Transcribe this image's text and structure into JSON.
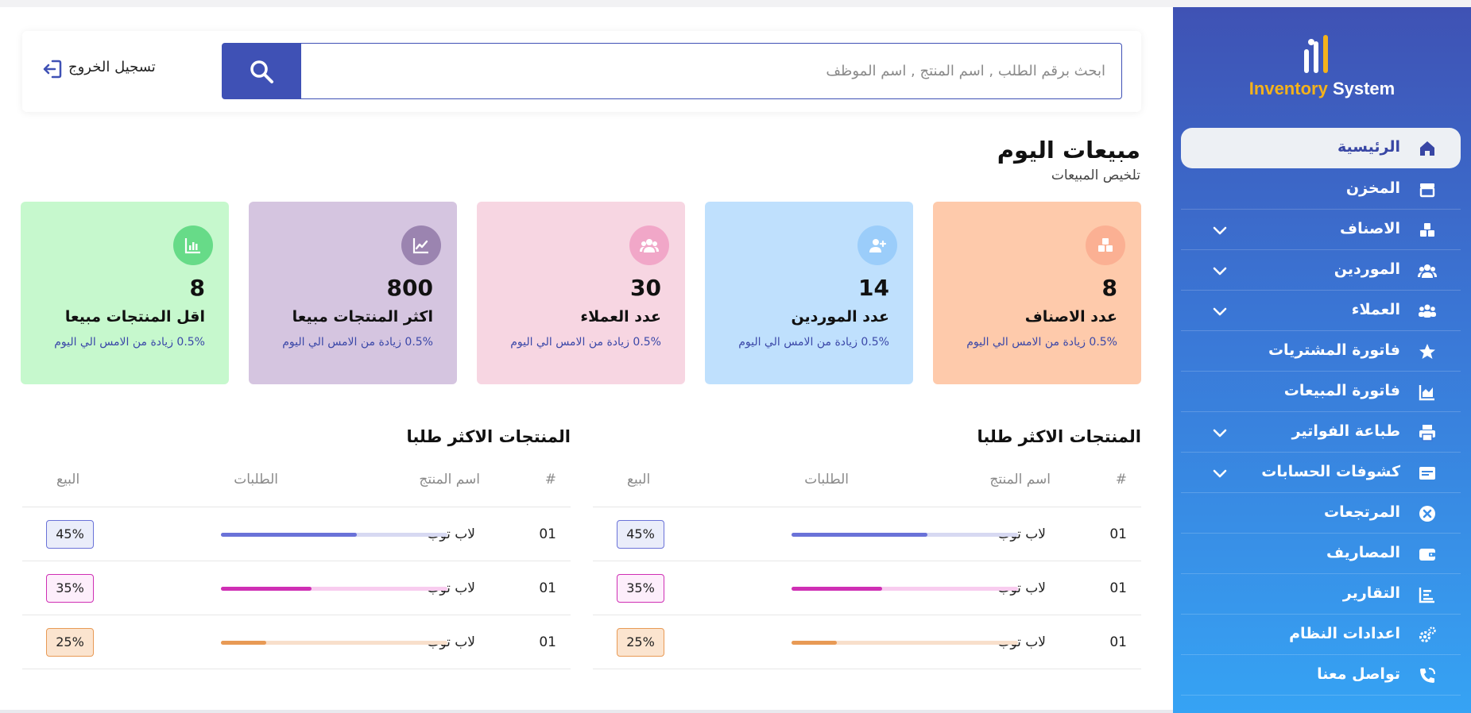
{
  "sidebar": {
    "logo": {
      "word1": "Inventory",
      "word2": "System"
    },
    "items": [
      {
        "label": "الرئيسية",
        "icon": "home-icon",
        "active": true,
        "has_submenu": false
      },
      {
        "label": "المخزن",
        "icon": "store-icon",
        "active": false,
        "has_submenu": false
      },
      {
        "label": "الاصناف",
        "icon": "boxes-icon",
        "active": false,
        "has_submenu": true
      },
      {
        "label": "الموردين",
        "icon": "users-icon",
        "active": false,
        "has_submenu": true
      },
      {
        "label": "العملاء",
        "icon": "customers-icon",
        "active": false,
        "has_submenu": true
      },
      {
        "label": "فاتورة المشتريات",
        "icon": "star-icon",
        "active": false,
        "has_submenu": false
      },
      {
        "label": "فاتورة المبيعات",
        "icon": "area-chart-icon",
        "active": false,
        "has_submenu": false
      },
      {
        "label": "طباعة الفواتير",
        "icon": "printer-icon",
        "active": false,
        "has_submenu": true
      },
      {
        "label": "كشوفات الحسابات",
        "icon": "id-card-icon",
        "active": false,
        "has_submenu": true
      },
      {
        "label": "المرتجعات",
        "icon": "x-circle-icon",
        "active": false,
        "has_submenu": false
      },
      {
        "label": "المصاريف",
        "icon": "wallet-icon",
        "active": false,
        "has_submenu": false
      },
      {
        "label": "التقارير",
        "icon": "report-icon",
        "active": false,
        "has_submenu": false
      },
      {
        "label": "اعدادات النظام",
        "icon": "gears-icon",
        "active": false,
        "has_submenu": false
      },
      {
        "label": "تواصل معنا",
        "icon": "phone-icon",
        "active": false,
        "has_submenu": false
      }
    ]
  },
  "header": {
    "search_placeholder": "ابحث برقم الطلب , اسم المنتج , اسم الموظف",
    "logout_label": "تسجيل الخروج"
  },
  "summary": {
    "title": "مبيعات اليوم",
    "subtitle": "تلخيص المبيعات"
  },
  "cards": [
    {
      "value": "8",
      "label": "عدد الاصناف",
      "delta": "0.5% زيادة من الامس الي اليوم",
      "icon": "boxes-icon",
      "bg": "#fecaab",
      "icon_bg": "#fbb093"
    },
    {
      "value": "14",
      "label": "عدد الموردين",
      "delta": "0.5% زيادة من الامس الي اليوم",
      "icon": "user-plus-icon",
      "bg": "#bfe0fd",
      "icon_bg": "#9bcdfa"
    },
    {
      "value": "30",
      "label": "عدد العملاء",
      "delta": "0.5% زيادة من الامس الي اليوم",
      "icon": "users-icon",
      "bg": "#f7d6e2",
      "icon_bg": "#f1a7c8"
    },
    {
      "value": "800",
      "label": "اكثر المنتجات مبيعا",
      "delta": "0.5% زيادة من الامس الي اليوم",
      "icon": "line-chart-icon",
      "bg": "#d5c5e0",
      "icon_bg": "#9b84b0"
    },
    {
      "value": "8",
      "label": "اقل المنتجات مبيعا",
      "delta": "0.5% زيادة من الامس الي اليوم",
      "icon": "bar-chart-icon",
      "bg": "#c6f8cd",
      "icon_bg": "#67db88"
    }
  ],
  "tables": [
    {
      "title": "المنتجات الاكثر طلبا",
      "headers": {
        "num": "#",
        "name": "اسم المنتج",
        "orders": "الطلبات",
        "sale": "البيع"
      },
      "rows": [
        {
          "num": "01",
          "name": "لاب توب",
          "progress": 0.6,
          "sale": "45%",
          "color": "#6a72d8",
          "track": "#d7d9f2",
          "badge_bg": "#eaedfa",
          "badge_border": "#6a72d8"
        },
        {
          "num": "01",
          "name": "لاب توب",
          "progress": 0.4,
          "sale": "35%",
          "color": "#cf2fb4",
          "track": "#f8ccef",
          "badge_bg": "#fdeefb",
          "badge_border": "#cf2fb4"
        },
        {
          "num": "01",
          "name": "لاب توب",
          "progress": 0.2,
          "sale": "25%",
          "color": "#e89a55",
          "track": "#f8dfcb",
          "badge_bg": "#fbe4cf",
          "badge_border": "#e89a55"
        }
      ]
    },
    {
      "title": "المنتجات الاكثر طلبا",
      "headers": {
        "num": "#",
        "name": "اسم المنتج",
        "orders": "الطلبات",
        "sale": "البيع"
      },
      "rows": [
        {
          "num": "01",
          "name": "لاب توب",
          "progress": 0.6,
          "sale": "45%",
          "color": "#6a72d8",
          "track": "#d7d9f2",
          "badge_bg": "#eaedfa",
          "badge_border": "#6a72d8"
        },
        {
          "num": "01",
          "name": "لاب توب",
          "progress": 0.4,
          "sale": "35%",
          "color": "#cf2fb4",
          "track": "#f8ccef",
          "badge_bg": "#fdeefb",
          "badge_border": "#cf2fb4"
        },
        {
          "num": "01",
          "name": "لاب توب",
          "progress": 0.2,
          "sale": "25%",
          "color": "#e89a55",
          "track": "#f8dfcb",
          "badge_bg": "#fbe4cf",
          "badge_border": "#e89a55"
        }
      ]
    }
  ]
}
